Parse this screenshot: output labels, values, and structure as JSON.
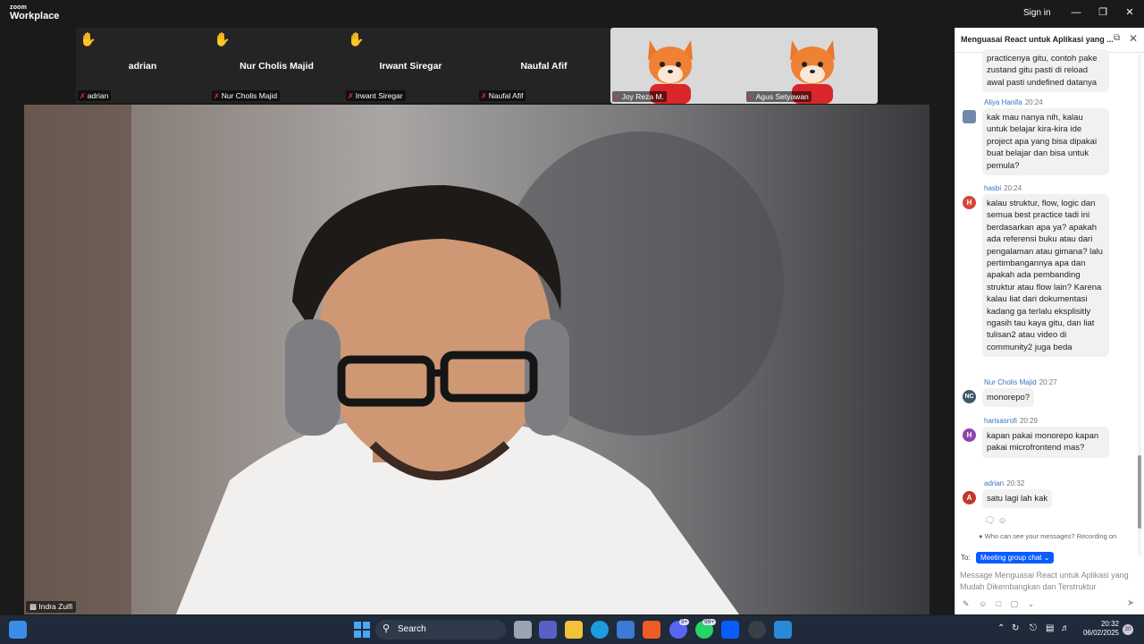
{
  "app": {
    "logo_small": "zoom",
    "logo_big": "Workplace",
    "signin": "Sign in"
  },
  "gallery": {
    "tiles": [
      {
        "name": "adrian",
        "tag": "adrian"
      },
      {
        "name": "Nur Cholis Majid",
        "tag": "Nur Cholis Majid"
      },
      {
        "name": "Irwant Siregar",
        "tag": "Irwant Siregar"
      },
      {
        "name": "Naufal Afif",
        "tag": "Naufal Afif"
      }
    ],
    "avatars": [
      {
        "tag": "Joy Reza M."
      },
      {
        "tag": "Agus Setyawan"
      }
    ]
  },
  "main": {
    "speaker": "Indra Zulfi"
  },
  "chat": {
    "title": "Menguasai React untuk Aplikasi yang ...",
    "messages": [
      {
        "text": "practicenya gitu, contoh pake zustand gitu pasti di reload awal pasti undefined datanya"
      },
      {
        "name": "Aliya Hanifa",
        "time": "20:24",
        "text": "kak mau nanya nih, kalau untuk belajar kira-kira ide project apa yang bisa dipakai buat belajar dan bisa untuk pemula?"
      },
      {
        "name": "hasbi",
        "time": "20:24",
        "avatar": "H",
        "text": "kalau struktur, flow, logic dan semua best practice tadi ini berdasarkan apa ya? apakah ada referensi buku atau dari pengalaman atau gimana? lalu pertimbangannya apa dan apakah ada pembanding struktur atau flow lain? Karena kalau liat dari dokumentasi kadang ga terlalu eksplisitly ngasih tau kaya gitu, dan liat tulisan2 atau video di community2 juga beda"
      },
      {
        "name": "Nur Cholis Majid",
        "time": "20:27",
        "avatar": "NC",
        "text": "monorepo?"
      },
      {
        "name": "harisasrofi",
        "time": "20:29",
        "avatar": "H",
        "text": "kapan pakai monorepo kapan pakai microfrontend mas?"
      },
      {
        "name": "adrian",
        "time": "20:32",
        "avatar": "A",
        "text": "satu lagi lah kak"
      }
    ],
    "privacy": "Who can see your messages? Recording on",
    "to_label": "To:",
    "to_target": "Meeting group chat ⌄",
    "compose_placeholder": "Message Menguasai React untuk Aplikasi yang Mudah Dikembangkan dan Terstruktur"
  },
  "taskbar": {
    "search": "Search",
    "discord_badge": "9+",
    "whatsapp_badge": "99+",
    "time": "20:32",
    "date": "06/02/2025",
    "notifications": "20"
  },
  "colors": {
    "accent": "#0b5cff",
    "mic_off": "#e0393e",
    "raised_hand": "#f3b41b",
    "chat_name": "#3b74c5"
  }
}
